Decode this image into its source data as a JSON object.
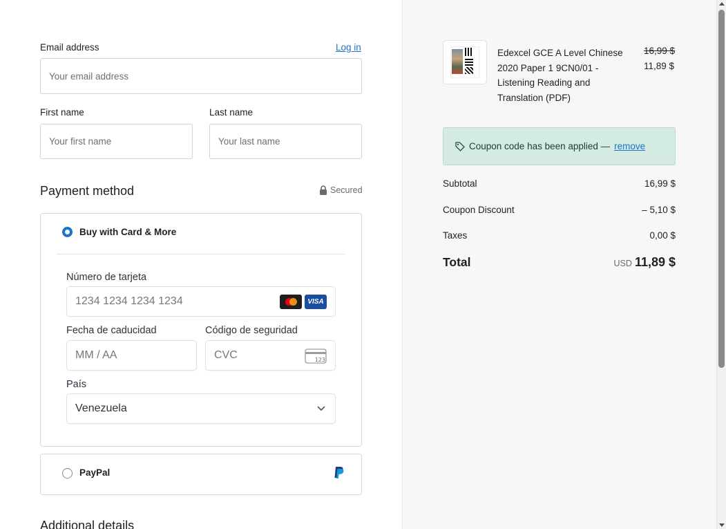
{
  "form": {
    "email_label": "Email address",
    "login_link": "Log in",
    "email_placeholder": "Your email address",
    "first_name_label": "First name",
    "first_name_placeholder": "Your first name",
    "last_name_label": "Last name",
    "last_name_placeholder": "Your last name"
  },
  "payment": {
    "title": "Payment method",
    "secured": "Secured",
    "card_option": "Buy with Card & More",
    "card_number_label": "Número de tarjeta",
    "card_number_placeholder": "1234 1234 1234 1234",
    "visa": "VISA",
    "expiry_label": "Fecha de caducidad",
    "expiry_placeholder": "MM / AA",
    "cvc_label": "Código de seguridad",
    "cvc_placeholder": "CVC",
    "cvc_icon_text": "123",
    "country_label": "País",
    "country_value": "Venezuela",
    "paypal_option": "PayPal"
  },
  "additional": {
    "title": "Additional details"
  },
  "product": {
    "title": "Edexcel GCE A Level Chinese 2020 Paper 1 9CN0/01 - Listening Reading and Translation (PDF)",
    "old_price": "16,99 $",
    "new_price": "11,89 $"
  },
  "coupon": {
    "text": "Coupon code has been applied —",
    "remove": "remove"
  },
  "summary": {
    "subtotal_label": "Subtotal",
    "subtotal_value": "16,99 $",
    "discount_label": "Coupon Discount",
    "discount_value": "– 5,10 $",
    "taxes_label": "Taxes",
    "taxes_value": "0,00 $",
    "total_label": "Total",
    "currency": "USD",
    "total_value": "11,89 $"
  },
  "colors": {
    "accent": "#1a73c8",
    "coupon_bg": "#d4ebe3",
    "summary_bg": "#f7f7f7"
  }
}
